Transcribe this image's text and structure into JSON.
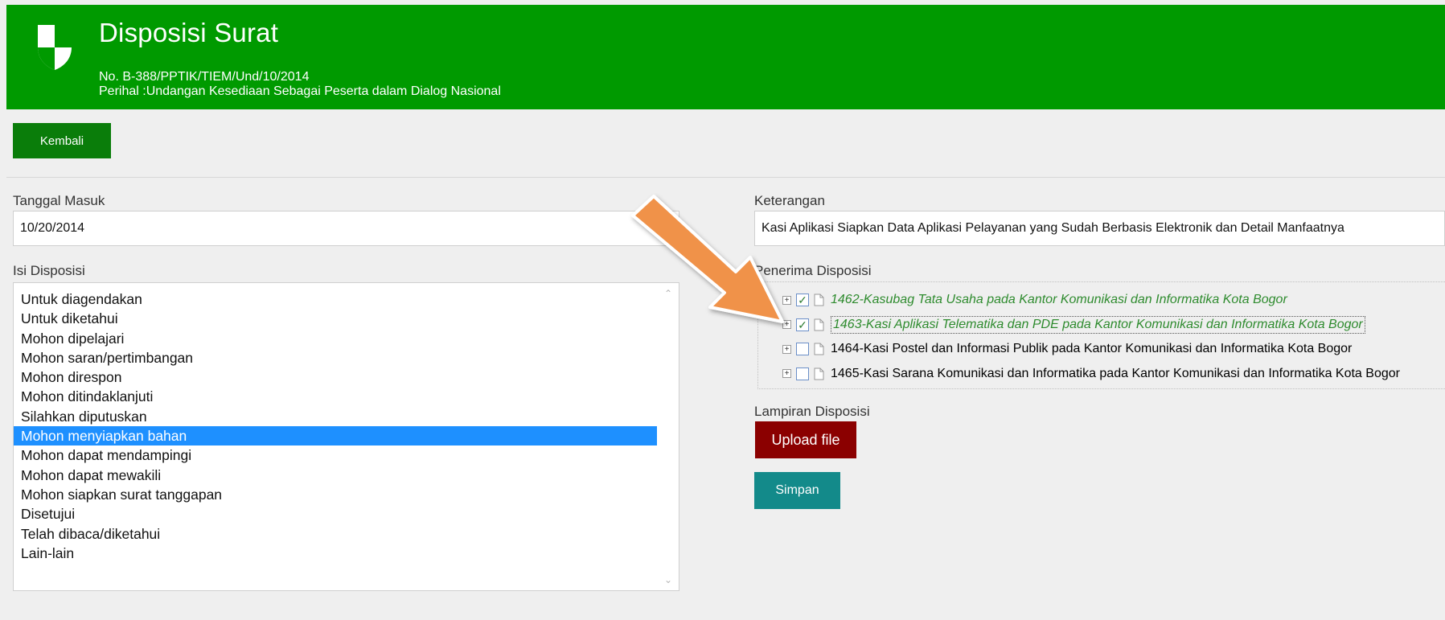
{
  "header": {
    "title": "Disposisi Surat",
    "number_line": "No. B-388/PPTIK/TIEM/Und/10/2014",
    "perihal_line": "Perihal :Undangan Kesediaan Sebagai Peserta dalam Dialog Nasional",
    "bg_color": "#009a00"
  },
  "back_button": {
    "label": "Kembali"
  },
  "tanggal_masuk": {
    "label": "Tanggal Masuk",
    "value": "10/20/2014"
  },
  "keterangan": {
    "label": "Keterangan",
    "value": "Kasi Aplikasi Siapkan Data Aplikasi Pelayanan yang Sudah Berbasis Elektronik dan Detail Manfaatnya"
  },
  "isi_disposisi": {
    "label": "Isi Disposisi",
    "items": [
      "Untuk diagendakan",
      "Untuk diketahui",
      "Mohon dipelajari",
      "Mohon saran/pertimbangan",
      "Mohon direspon",
      "Mohon ditindaklanjuti",
      "Silahkan diputuskan",
      "Mohon menyiapkan bahan",
      "Mohon dapat mendampingi",
      "Mohon dapat mewakili",
      "Mohon siapkan surat tanggapan",
      "Disetujui",
      "Telah dibaca/diketahui",
      "Lain-lain"
    ],
    "selected_item": "Mohon menyiapkan bahan"
  },
  "penerima_disposisi": {
    "label": "Penerima Disposisi",
    "items": [
      {
        "label": "1462-Kasubag Tata Usaha pada Kantor Komunikasi dan Informatika Kota Bogor",
        "checked": true
      },
      {
        "label": "1463-Kasi Aplikasi Telematika dan PDE pada Kantor Komunikasi dan Informatika Kota Bogor",
        "checked": true
      },
      {
        "label": "1464-Kasi Postel dan Informasi Publik pada Kantor Komunikasi dan Informatika Kota Bogor",
        "checked": false
      },
      {
        "label": "1465-Kasi Sarana Komunikasi dan Informatika pada Kantor Komunikasi dan Informatika Kota Bogor",
        "checked": false
      }
    ]
  },
  "lampiran": {
    "label": "Lampiran Disposisi",
    "upload_label": "Upload file"
  },
  "save_button": {
    "label": "Simpan"
  },
  "icons": {
    "logo": "shield-icon",
    "expander": "plus-box-icon",
    "document": "document-icon",
    "annotation": "arrow-icon"
  }
}
